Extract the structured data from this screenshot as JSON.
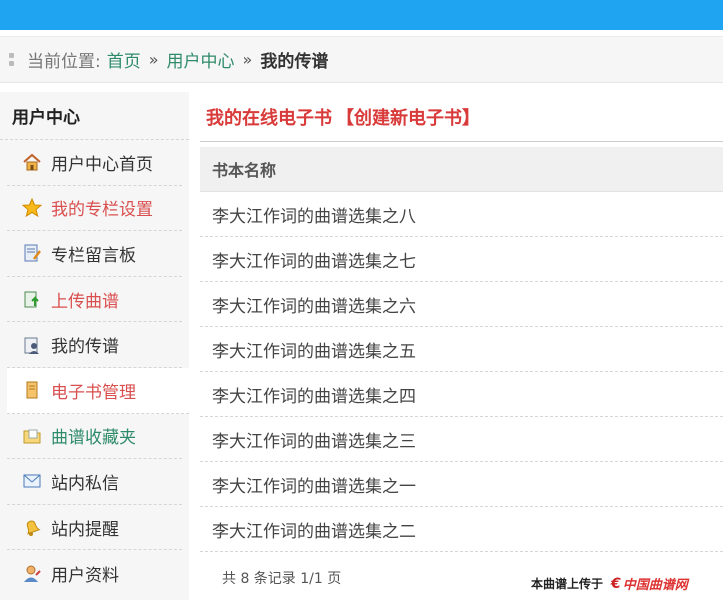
{
  "breadcrumb": {
    "label": "当前位置:",
    "items": [
      "首页",
      "用户中心"
    ],
    "separator": "»",
    "current": "我的传谱"
  },
  "sidebar": {
    "title": "用户中心",
    "items": [
      {
        "label": "用户中心首页",
        "icon": "home-icon",
        "color": "#333333"
      },
      {
        "label": "我的专栏设置",
        "icon": "star-icon",
        "color": "#d94f4f"
      },
      {
        "label": "专栏留言板",
        "icon": "note-icon",
        "color": "#333333"
      },
      {
        "label": "上传曲谱",
        "icon": "upload-icon",
        "color": "#d94f4f"
      },
      {
        "label": "我的传谱",
        "icon": "user-doc-icon",
        "color": "#333333"
      },
      {
        "label": "电子书管理",
        "icon": "book-icon",
        "color": "#d94f4f"
      },
      {
        "label": "曲谱收藏夹",
        "icon": "folder-icon",
        "color": "#2e8b6a"
      },
      {
        "label": "站内私信",
        "icon": "mail-icon",
        "color": "#333333"
      },
      {
        "label": "站内提醒",
        "icon": "bell-icon",
        "color": "#333333"
      },
      {
        "label": "用户资料",
        "icon": "profile-icon",
        "color": "#333333"
      }
    ]
  },
  "main": {
    "title": "我的在线电子书",
    "create_link": "【创建新电子书】",
    "table_header": "书本名称",
    "rows": [
      "李大江作词的曲谱选集之八",
      "李大江作词的曲谱选集之七",
      "李大江作词的曲谱选集之六",
      "李大江作词的曲谱选集之五",
      "李大江作词的曲谱选集之四",
      "李大江作词的曲谱选集之三",
      "李大江作词的曲谱选集之一",
      "李大江作词的曲谱选集之二"
    ],
    "pager": "共 8 条记录 1/1 页"
  },
  "footer": {
    "uploaded_text": "本曲谱上传于",
    "logo_text": "中国曲谱网"
  },
  "colors": {
    "topbar": "#1ea4f0",
    "accent_red": "#d93a3a",
    "link_green": "#2e8b6a"
  }
}
